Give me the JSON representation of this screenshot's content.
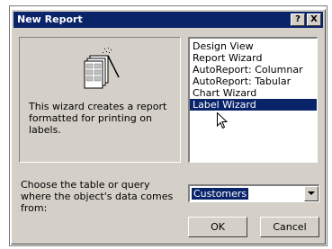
{
  "window": {
    "title": "New Report",
    "help_label": "?",
    "close_label": "X"
  },
  "preview": {
    "description": "This wizard creates a report formatted for printing on labels."
  },
  "report_types": {
    "items": [
      "Design View",
      "Report Wizard",
      "AutoReport:  Columnar",
      "AutoReport:  Tabular",
      "Chart Wizard",
      "Label Wizard"
    ],
    "selected": "Label Wizard"
  },
  "source": {
    "label": "Choose the table or query where the object's data comes from:",
    "value": "Customers"
  },
  "buttons": {
    "ok": "OK",
    "cancel": "Cancel"
  },
  "icons": {
    "illustration": "label-wizard-illustration-icon",
    "cursor": "arrow-cursor-icon",
    "dropdown": "chevron-down-icon"
  },
  "colors": {
    "selection": "#0a246a",
    "dialog_face": "#d4d0c8",
    "title_bar": "#0a246a"
  }
}
